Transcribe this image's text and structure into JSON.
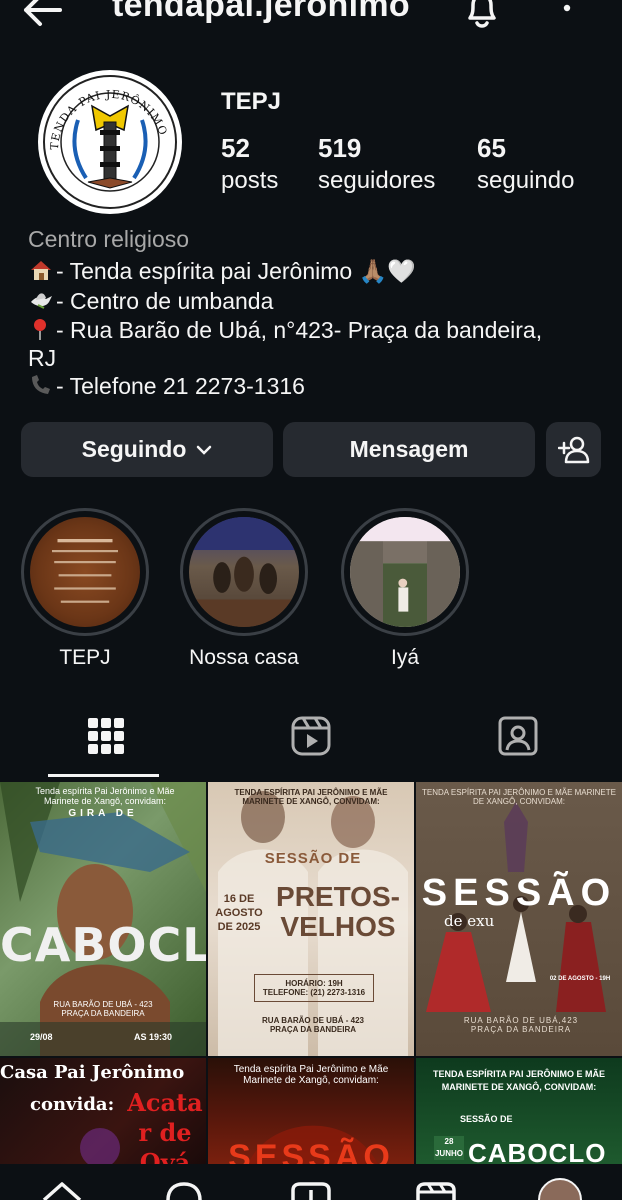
{
  "header": {
    "username": "tendapai.jeronimo"
  },
  "profile": {
    "display_name": "TEPJ",
    "logo_text": "TENDA PAI JERÔNIMO",
    "stats": [
      {
        "value": "52",
        "label": "posts"
      },
      {
        "value": "519",
        "label": "seguidores"
      },
      {
        "value": "65",
        "label": "seguindo"
      }
    ],
    "category": "Centro religioso",
    "bio": [
      {
        "icon": "house-icon",
        "text": "- Tenda espírita pai Jerônimo 🙏🏽🤍"
      },
      {
        "icon": "dove-icon",
        "text": "- Centro de umbanda"
      },
      {
        "icon": "pin-icon",
        "text": "- Rua Barão de Ubá, n°423- Praça da bandeira,"
      },
      {
        "icon": "",
        "text": "RJ"
      },
      {
        "icon": "phone-icon",
        "text": "- Telefone 21 2273-1316"
      }
    ]
  },
  "actions": {
    "following": "Seguindo",
    "message": "Mensagem"
  },
  "highlights": [
    {
      "label": "TEPJ"
    },
    {
      "label": "Nossa casa"
    },
    {
      "label": "Iyá"
    }
  ],
  "tabs": [
    "grid-icon",
    "reels-icon",
    "tagged-icon"
  ],
  "posts": [
    {
      "top": "Tenda espírita Pai Jerônimo e Mãe Marinete de Xangô, convidam:",
      "sub": "GIRA DE",
      "title": "CABOCLO",
      "address": "RUA BARÃO DE UBÁ - 423\nPRAÇA DA BANDEIRA",
      "date": "29/08",
      "time": "AS 19:30"
    },
    {
      "top": "TENDA ESPÍRITA PAI JERÔNIMO E MÃE MARINETE DE XANGÔ, CONVIDAM:",
      "sub": "SESSÃO DE",
      "title": "PRETOS-VELHOS",
      "date": "16 DE AGOSTO DE 2025",
      "info": "HORÁRIO: 19H\nTELEFONE: (21) 2273-1316",
      "address": "RUA BARÃO DE UBÁ - 423\nPRAÇA DA BANDEIRA"
    },
    {
      "top": "TENDA ESPÍRITA PAI JERÔNIMO E MÃE MARINETE DE XANGÔ, CONVIDAM:",
      "title": "SESSÃO",
      "sub": "de exu",
      "date": "02 DE AGOSTO - 19H",
      "address": "RUA BARÃO DE UBÁ,423\nPRAÇA DA BANDEIRA"
    },
    {
      "top": "Casa Pai Jerônimo",
      "sub": "convida:",
      "title": "Acatar de Oyá"
    },
    {
      "top": "Tenda espírita Pai Jerônimo e Mãe Marinete de Xangô, convidam:",
      "title": "SESSÃO"
    },
    {
      "top": "TENDA ESPÍRITA PAI JERÔNIMO E MÃE MARINETE DE XANGÔ, CONVIDAM:",
      "sub": "SESSÃO DE",
      "date": "28 JUNHO",
      "title": "CABOCLO"
    }
  ]
}
